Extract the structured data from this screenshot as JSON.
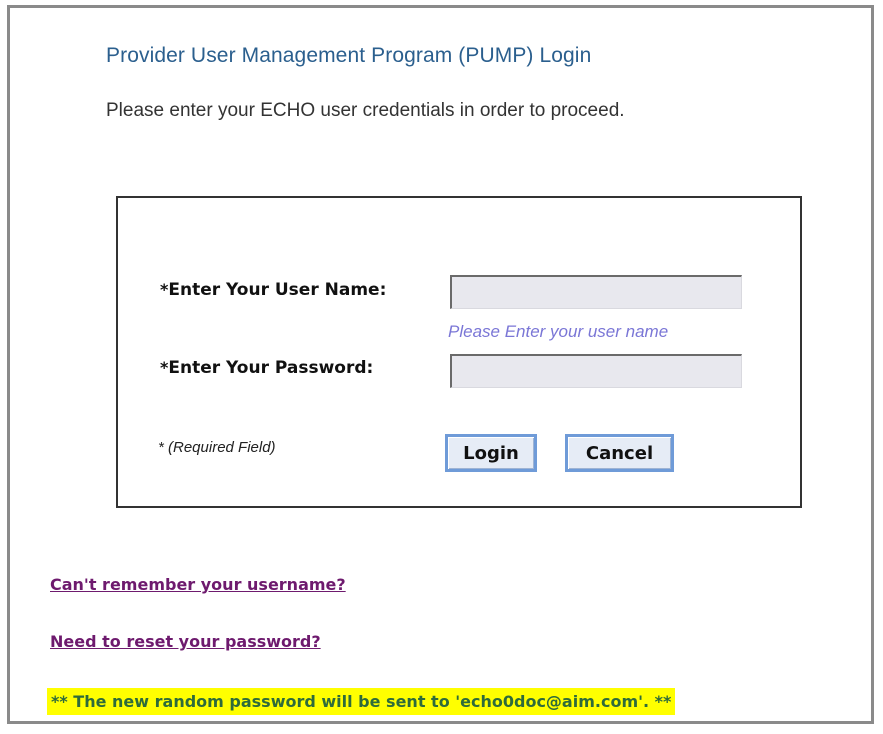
{
  "page": {
    "title": "Provider User Management Program (PUMP) Login",
    "intro": "Please enter your ECHO user credentials in order to proceed."
  },
  "form": {
    "username_label": "Enter Your User Name:",
    "username_value": "",
    "username_hint": "Please Enter your user name",
    "password_label": "Enter Your Password:",
    "password_value": "",
    "required_star": "*",
    "required_note": "(Required Field)",
    "login_button": "Login",
    "cancel_button": "Cancel"
  },
  "links": {
    "forgot_username": "Can't remember your username?",
    "reset_password": "Need to reset your password?"
  },
  "notice": {
    "text": "** The new random password will be sent to 'echo0doc@aim.com'. **"
  },
  "colors": {
    "title": "#2b5f8e",
    "hint": "#7a76d6",
    "link": "#6e1a6e",
    "notice_bg": "#ffff00",
    "notice_text": "#2e6b3b"
  }
}
